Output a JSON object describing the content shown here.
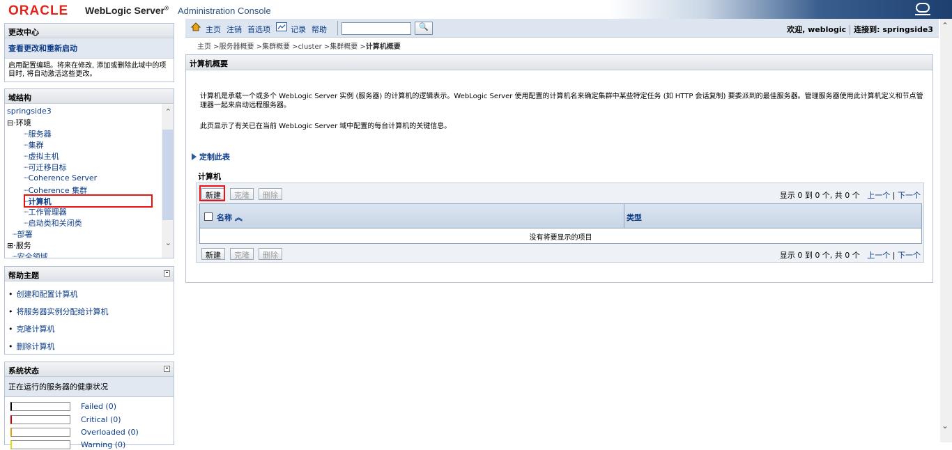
{
  "header": {
    "logo": "ORACLE",
    "product": "WebLogic Server",
    "reg": "®",
    "subtitle": "Administration Console"
  },
  "toolbar": {
    "home": "主页",
    "logout": "注销",
    "prefs": "首选项",
    "record": "记录",
    "help": "帮助",
    "welcome": "欢迎, weblogic",
    "connected": "连接到: springside3"
  },
  "breadcrumb": {
    "path": "主页 >服务器概要 >集群概要 >cluster >集群概要 >",
    "current": "计算机概要"
  },
  "change_center": {
    "title": "更改中心",
    "link": "查看更改和重新启动",
    "desc": "启用配置编辑。将来在修改, 添加或删除此域中的项目时, 将自动激活这些更改。"
  },
  "domain_structure": {
    "title": "域结构",
    "items": [
      "springside3",
      "环境",
      "服务器",
      "集群",
      "虚拟主机",
      "可迁移目标",
      "Coherence Server",
      "Coherence 集群",
      "计算机",
      "工作管理器",
      "启动类和关闭类",
      "部署",
      "服务",
      "安全领域"
    ]
  },
  "help_topics": {
    "title": "帮助主题",
    "items": [
      "创建和配置计算机",
      "将服务器实例分配给计算机",
      "克隆计算机",
      "删除计算机"
    ]
  },
  "system_status": {
    "title": "系统状态",
    "subtitle": "正在运行的服务器的健康状况",
    "rows": [
      {
        "label": "Failed (0)",
        "color": "#000000"
      },
      {
        "label": "Critical (0)",
        "color": "#cc0000"
      },
      {
        "label": "Overloaded (0)",
        "color": "#e8a000"
      },
      {
        "label": "Warning (0)",
        "color": "#e8e000"
      }
    ]
  },
  "content": {
    "title": "计算机概要",
    "intro": "计算机是承载一个或多个 WebLogic Server 实例 (服务器) 的计算机的逻辑表示。WebLogic Server 使用配置的计算机名来确定集群中某些特定任务 (如 HTTP 会话复制) 要委派到的最佳服务器。管理服务器使用此计算机定义和节点管理器一起来启动远程服务器。",
    "intro2": "此页显示了有关已在当前 WebLogic Server 域中配置的每台计算机的关键信息。",
    "customize": "定制此表",
    "table_title": "计算机",
    "btn_new": "新建",
    "btn_clone": "克隆",
    "btn_delete": "删除",
    "pager_info": "显示 0 到 0 个, 共 0 个",
    "pager_prev": "上一个",
    "pager_next": "下一个",
    "col_name": "名称",
    "col_type": "类型",
    "empty": "没有将要显示的项目"
  }
}
